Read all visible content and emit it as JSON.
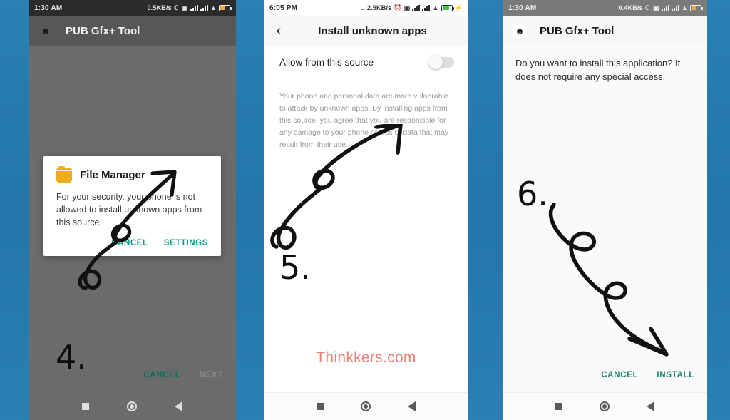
{
  "background": {
    "color": "#2478b0"
  },
  "watermark": {
    "text": "Thinkkers.com",
    "color": "#ec7f76"
  },
  "panels": [
    {
      "id": "panel-1-file-manager-block",
      "statusbar": {
        "time": "1:30 AM",
        "network_speed": "0.5KB/s",
        "icons": [
          "moon-icon",
          "screenshot-icon",
          "signal-bars-icon",
          "signal-bars-icon",
          "wifi-icon",
          "battery-icon"
        ],
        "battery_level": "amber"
      },
      "appbar": {
        "title": "PUB Gfx+ Tool",
        "icon": "app-logo-icon"
      },
      "dialog": {
        "icon": "folder-icon",
        "title": "File Manager",
        "message": "For your security, your phone is not allowed to install unknown apps from this source.",
        "buttons": [
          {
            "label": "CANCEL",
            "name": "dialog-cancel-button"
          },
          {
            "label": "SETTINGS",
            "name": "dialog-settings-button"
          }
        ]
      },
      "bottom_actions": [
        {
          "label": "CANCEL",
          "enabled": true
        },
        {
          "label": "NEXT",
          "enabled": false
        }
      ],
      "step_number": "4.",
      "navbar": [
        "recents-square-icon",
        "home-circle-icon",
        "back-triangle-icon"
      ]
    },
    {
      "id": "panel-2-install-unknown-apps",
      "statusbar": {
        "time": "6:05 PM",
        "network_speed": "...2.5KB/s",
        "icons": [
          "alarm-icon",
          "screenshot-icon",
          "signal-bars-icon",
          "signal-bars-icon",
          "wifi-icon",
          "battery-icon",
          "charging-bolt-icon"
        ],
        "battery_level": "green"
      },
      "appbar": {
        "title": "Install unknown apps",
        "back": "back-chevron-icon"
      },
      "allow_row": {
        "label": "Allow from this source",
        "toggle_state": "off"
      },
      "help_text": "Your phone and personal data are more vulnerable to attack by unknown apps. By installing apps from this source, you agree that you are responsible for any damage to your phone or loss of data that may result from their use.",
      "step_number": "5.",
      "navbar": [
        "recents-square-icon",
        "home-circle-icon",
        "back-triangle-icon"
      ]
    },
    {
      "id": "panel-3-install-confirm",
      "statusbar": {
        "time": "1:30 AM",
        "network_speed": "0.4KB/s",
        "icons": [
          "moon-icon",
          "screenshot-icon",
          "signal-bars-icon",
          "signal-bars-icon",
          "wifi-icon",
          "battery-icon"
        ],
        "battery_level": "amber"
      },
      "appbar": {
        "title": "PUB Gfx+ Tool",
        "icon": "app-logo-icon"
      },
      "question": "Do you want to install this application? It does not require any special access.",
      "bottom_actions": [
        {
          "label": "CANCEL",
          "enabled": true
        },
        {
          "label": "INSTALL",
          "enabled": true
        }
      ],
      "step_number": "6.",
      "navbar": [
        "recents-square-icon",
        "home-circle-icon",
        "back-triangle-icon"
      ]
    }
  ]
}
